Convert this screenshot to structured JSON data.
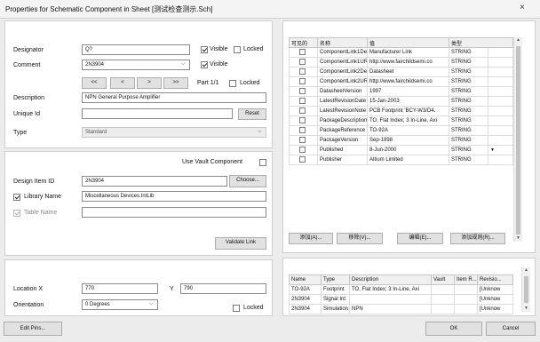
{
  "window": {
    "title": "Properties for Schematic Component in Sheet [测试检查测示.Sch]",
    "close_glyph": "×"
  },
  "properties_panel": {
    "designator_label": "Designator",
    "designator_value": "Q?",
    "designator_visible_label": "Visible",
    "designator_locked_label": "Locked",
    "comment_label": "Comment",
    "comment_value": "2N3904",
    "comment_visible_label": "Visible",
    "part_nav": [
      "<<",
      "<",
      ">",
      ">>"
    ],
    "part_label": "Part 1/1",
    "part_locked_label": "Locked",
    "description_label": "Description",
    "description_value": "NPN General Purpose Amplifier",
    "unique_id_label": "Unique Id",
    "unique_id_value": "",
    "reset_label": "Reset",
    "type_label": "Type",
    "type_value": "Standard"
  },
  "library_panel": {
    "use_vault_label": "Use Vault Component",
    "design_item_label": "Design Item ID",
    "design_item_value": "2N3904",
    "choose_label": "Choose...",
    "library_name_label": "Library Name",
    "library_name_value": "Miscellaneous Devices.IntLib",
    "table_name_label": "Table Name",
    "table_name_value": "",
    "validate_label": "Validate Link"
  },
  "graphical_panel": {
    "location_x_label": "Location  X",
    "location_x_value": "770",
    "location_y_label": "Y",
    "location_y_value": "790",
    "orientation_label": "Orientation",
    "orientation_value": "0 Degrees",
    "locked_label": "Locked"
  },
  "params_panel": {
    "headers": [
      "可见的",
      "名称",
      "值",
      "类型"
    ],
    "rows": [
      {
        "visible": false,
        "name": "ComponentLink1Des",
        "value": "Manufacturer Link",
        "type": "STRING"
      },
      {
        "visible": false,
        "name": "ComponentLink1URL",
        "value": "http://www.fairchildsemi.co",
        "type": "STRING"
      },
      {
        "visible": false,
        "name": "ComponentLink2Des",
        "value": "Datasheet",
        "type": "STRING"
      },
      {
        "visible": false,
        "name": "ComponentLink2URL",
        "value": "http://www.fairchildsemi.co",
        "type": "STRING"
      },
      {
        "visible": false,
        "name": "DatasheetVersion",
        "value": "1997",
        "type": "STRING"
      },
      {
        "visible": false,
        "name": "LatestRevisionDate",
        "value": "15-Jan-2003",
        "type": "STRING"
      },
      {
        "visible": false,
        "name": "LatestRevisionNote",
        "value": "PCB Footprint 'BCY-W3/D4.",
        "type": "STRING"
      },
      {
        "visible": false,
        "name": "PackageDescription",
        "value": "TO, Flat Index; 3 In-Line, Axi",
        "type": "STRING"
      },
      {
        "visible": false,
        "name": "PackageReference",
        "value": "TO-92A",
        "type": "STRING"
      },
      {
        "visible": false,
        "name": "PackageVersion",
        "value": "Sep-1998",
        "type": "STRING"
      },
      {
        "visible": false,
        "name": "Published",
        "value": "8-Jun-2000",
        "type": "STRING"
      },
      {
        "visible": false,
        "name": "Publisher",
        "value": "Altium Limited",
        "type": "STRING"
      }
    ],
    "buttons": [
      "添加(A)...",
      "移除(V)...",
      "编辑(E)...",
      "添加规则(R)..."
    ]
  },
  "models_panel": {
    "headers": [
      "Name",
      "Type",
      "Description",
      "Vault",
      "Item R...",
      "Revisio..."
    ],
    "rows": [
      {
        "name": "TO-92A",
        "type": "Footprint",
        "description": "TO, Flat Index; 3 In-Line, Axi",
        "vault": "",
        "item": "",
        "revision": "[Unknow"
      },
      {
        "name": "2N3904",
        "type": "Signal Int",
        "description": "",
        "vault": "",
        "item": "",
        "revision": "[Unknow"
      },
      {
        "name": "2N3904",
        "type": "Simulation",
        "description": "NPN",
        "vault": "",
        "item": "",
        "revision": "[Unknow"
      }
    ]
  },
  "footer": {
    "edit_pins_label": "Edit Pins...",
    "ok_label": "OK",
    "cancel_label": "Cancel"
  }
}
